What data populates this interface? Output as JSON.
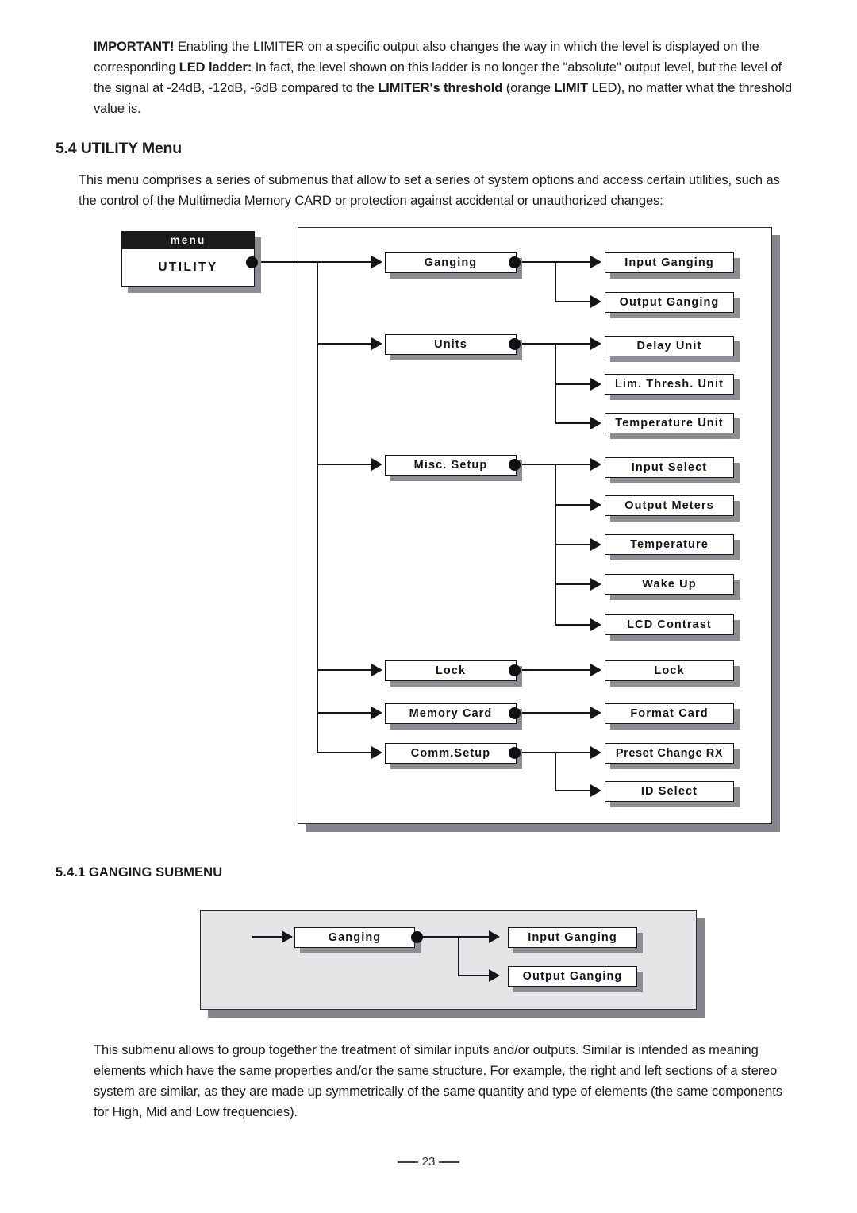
{
  "important_note": {
    "lead": "IMPORTANT!",
    "text_1": " Enabling the LIMITER on a specific output also changes the way in which the level is displayed on the corresponding ",
    "bold_1": "LED ladder:",
    "text_2": " In fact, the level shown on this ladder is no longer the \"absolute\" output level, but the level of the signal at -24dB, -12dB, -6dB compared to the ",
    "bold_2": "LIMITER's threshold",
    "text_3": " (orange ",
    "bold_3": "LIMIT",
    "text_4": " LED), no matter what the threshold value is."
  },
  "section": {
    "heading": "5.4 UTILITY Menu",
    "intro": "This menu comprises a series of submenus that allow to set a series of system options and access certain utilities, such as the control of the Multimedia Memory CARD or protection against accidental or unauthorized changes:"
  },
  "subsection": {
    "heading": "5.4.1 GANGING SUBMENU",
    "body": "This submenu allows to group together the treatment of similar inputs and/or outputs. Similar is intended as meaning elements which have the same properties and/or the same structure. For example, the right and left sections of a stereo system are similar, as they are made up symmetrically of the same quantity and type of elements (the same components for High, Mid and Low frequencies)."
  },
  "utility_tree": {
    "root": {
      "header": "menu",
      "label": "UTILITY"
    },
    "branches": [
      {
        "label": "Ganging",
        "children": [
          "Input Ganging",
          "Output Ganging"
        ]
      },
      {
        "label": "Units",
        "children": [
          "Delay Unit",
          "Lim. Thresh. Unit",
          "Temperature Unit"
        ]
      },
      {
        "label": "Misc. Setup",
        "children": [
          "Input Select",
          "Output Meters",
          "Temperature",
          "Wake Up",
          "LCD Contrast"
        ]
      },
      {
        "label": "Lock",
        "children": [
          "Lock"
        ]
      },
      {
        "label": "Memory Card",
        "children": [
          "Format Card"
        ]
      },
      {
        "label": "Comm.Setup",
        "children": [
          "Preset Change RX",
          "ID Select"
        ]
      }
    ]
  },
  "ganging_tree": {
    "parent": "Ganging",
    "children": [
      "Input Ganging",
      "Output Ganging"
    ]
  },
  "footer": {
    "page_number": "23"
  },
  "colors": {
    "ink": "#16161a",
    "panel_shadow": "#85858c",
    "ganging_panel_fill": "#e5e5e7",
    "header_fill": "#1b1b1b"
  }
}
